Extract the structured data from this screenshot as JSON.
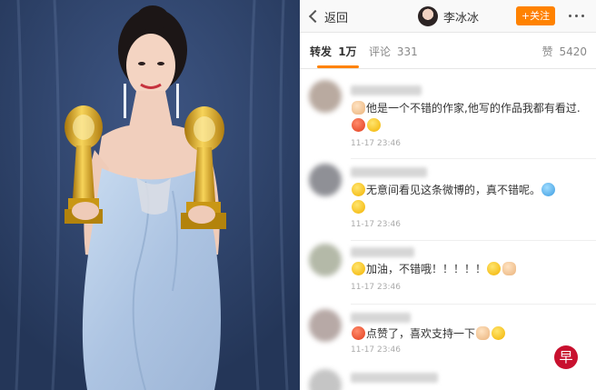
{
  "header": {
    "back_label": "返回",
    "user_name": "李冰冰",
    "follow_label": "+关注"
  },
  "tabs": {
    "repost_label": "转发",
    "repost_count": "1万",
    "comment_label": "评论",
    "comment_count": "331",
    "like_label": "赞",
    "like_count": "5420"
  },
  "comments": [
    {
      "text": "他是一个不错的作家,他写的作品我都有看过.",
      "time": "11-17 23:46"
    },
    {
      "text": "无意间看见这条微博的，真不错呢。",
      "time": "11-17 23:46"
    },
    {
      "text": "加油，不错哦！！！！！",
      "time": "11-17 23:46"
    },
    {
      "text": "点赞了，喜欢支持一下",
      "time": "11-17 23:46"
    }
  ],
  "watermark": "早",
  "colors": {
    "accent": "#ff8200",
    "photo_bg": "#2b3f66",
    "dress": "#b5cbe6",
    "trophy": "#d9a520"
  },
  "icons": [
    "chevron-left-icon",
    "more-dots-icon"
  ]
}
